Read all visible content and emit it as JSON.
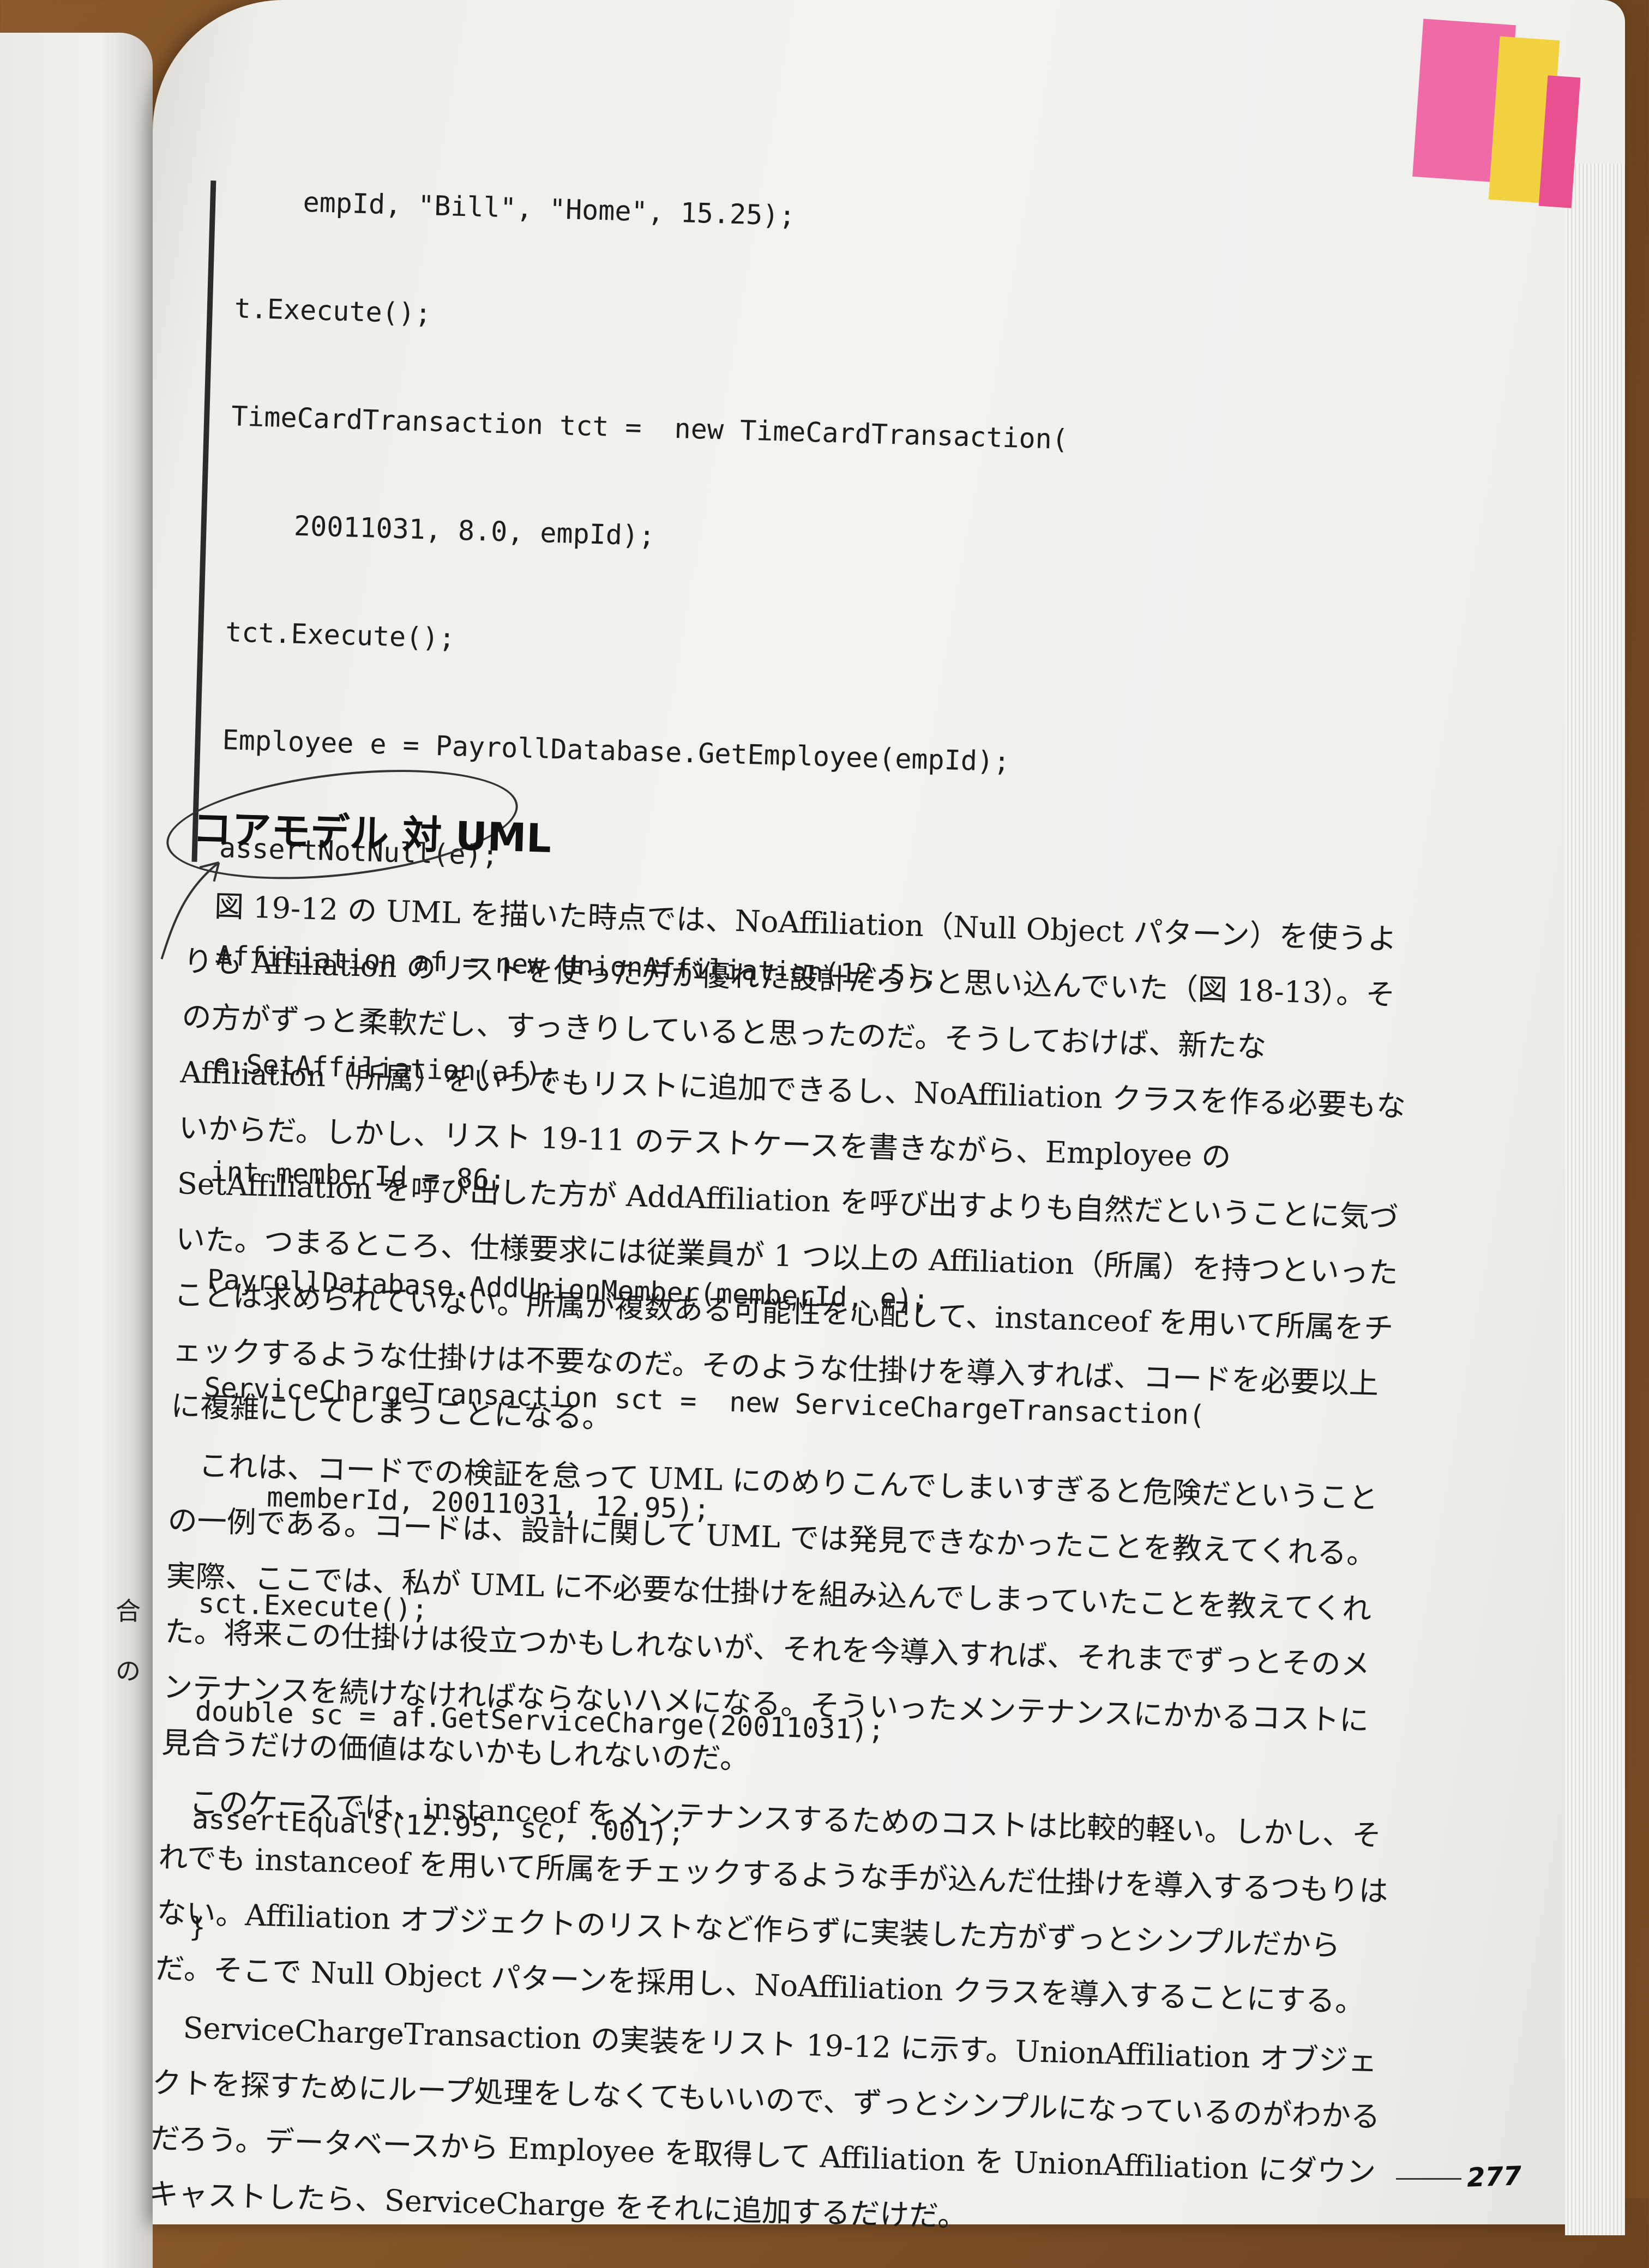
{
  "code_lines": [
    "    empId, \"Bill\", \"Home\", 15.25);",
    "t.Execute();",
    "TimeCardTransaction tct =  new TimeCardTransaction(",
    "    20011031, 8.0, empId);",
    "tct.Execute();",
    "Employee e = PayrollDatabase.GetEmployee(empId);",
    "assertNotNull(e);",
    "Affiliation af = new UnionAffiliation(12.5);",
    "e.SetAffiliation(af);",
    "int memberId = 86;",
    "PayrollDatabase.AddUnionMember(memberId, e);",
    "ServiceChargeTransaction sct =  new ServiceChargeTransaction(",
    "    memberId, 20011031, 12.95);",
    "sct.Execute();",
    "double sc = af.GetServiceCharge(20011031);",
    "assertEquals(12.95, sc, .001);",
    "}"
  ],
  "heading": "コアモデル 対 UML",
  "paragraphs": [
    "図 19-12 の UML を描いた時点では、NoAffiliation（Null Object パターン）を使うよりも Affiliation のリストを使った方が優れた設計だろうと思い込んでいた（図 18-13）。その方がずっと柔軟だし、すっきりしていると思ったのだ。そうしておけば、新たな Affiliation（所属）をいつでもリストに追加できるし、NoAffiliation クラスを作る必要もないからだ。しかし、リスト 19-11 のテストケースを書きながら、Employee の SetAffiliation を呼び出した方が AddAffiliation を呼び出すよりも自然だということに気づいた。つまるところ、仕様要求には従業員が 1 つ以上の Affiliation（所属）を持つといったことは求められていない。所属が複数ある可能性を心配して、instanceof を用いて所属をチェックするような仕掛けは不要なのだ。そのような仕掛けを導入すれば、コードを必要以上に複雑にしてしまうことになる。",
    "これは、コードでの検証を怠って UML にのめりこんでしまいすぎると危険だということの一例である。コードは、設計に関して UML では発見できなかったことを教えてくれる。実際、ここでは、私が UML に不必要な仕掛けを組み込んでしまっていたことを教えてくれた。将来この仕掛けは役立つかもしれないが、それを今導入すれば、それまでずっとそのメンテナンスを続けなければならないハメになる。そういったメンテナンスにかかるコストに見合うだけの価値はないかもしれないのだ。",
    "このケースでは、instanceof をメンテナンスするためのコストは比較的軽い。しかし、それでも instanceof を用いて所属をチェックするような手が込んだ仕掛けを導入するつもりはない。Affiliation オブジェクトのリストなど作らずに実装した方がずっとシンプルだからだ。そこで Null Object パターンを採用し、NoAffiliation クラスを導入することにする。",
    "ServiceChargeTransaction の実装をリスト 19-12 に示す。UnionAffiliation オブジェクトを探すためにループ処理をしなくてもいいので、ずっとシンプルになっているのがわかるだろう。データベースから Employee を取得して Affiliation を UnionAffiliation にダウンキャストしたら、ServiceCharge をそれに追加するだけだ。"
  ],
  "page_number": "277",
  "left_page_glyphs": [
    "合",
    "の"
  ],
  "colors": {
    "tab_pink": "#ef6aa7",
    "tab_yellow": "#f2d241",
    "paper": "#f2f2ef",
    "wood": "#7b4c24"
  }
}
